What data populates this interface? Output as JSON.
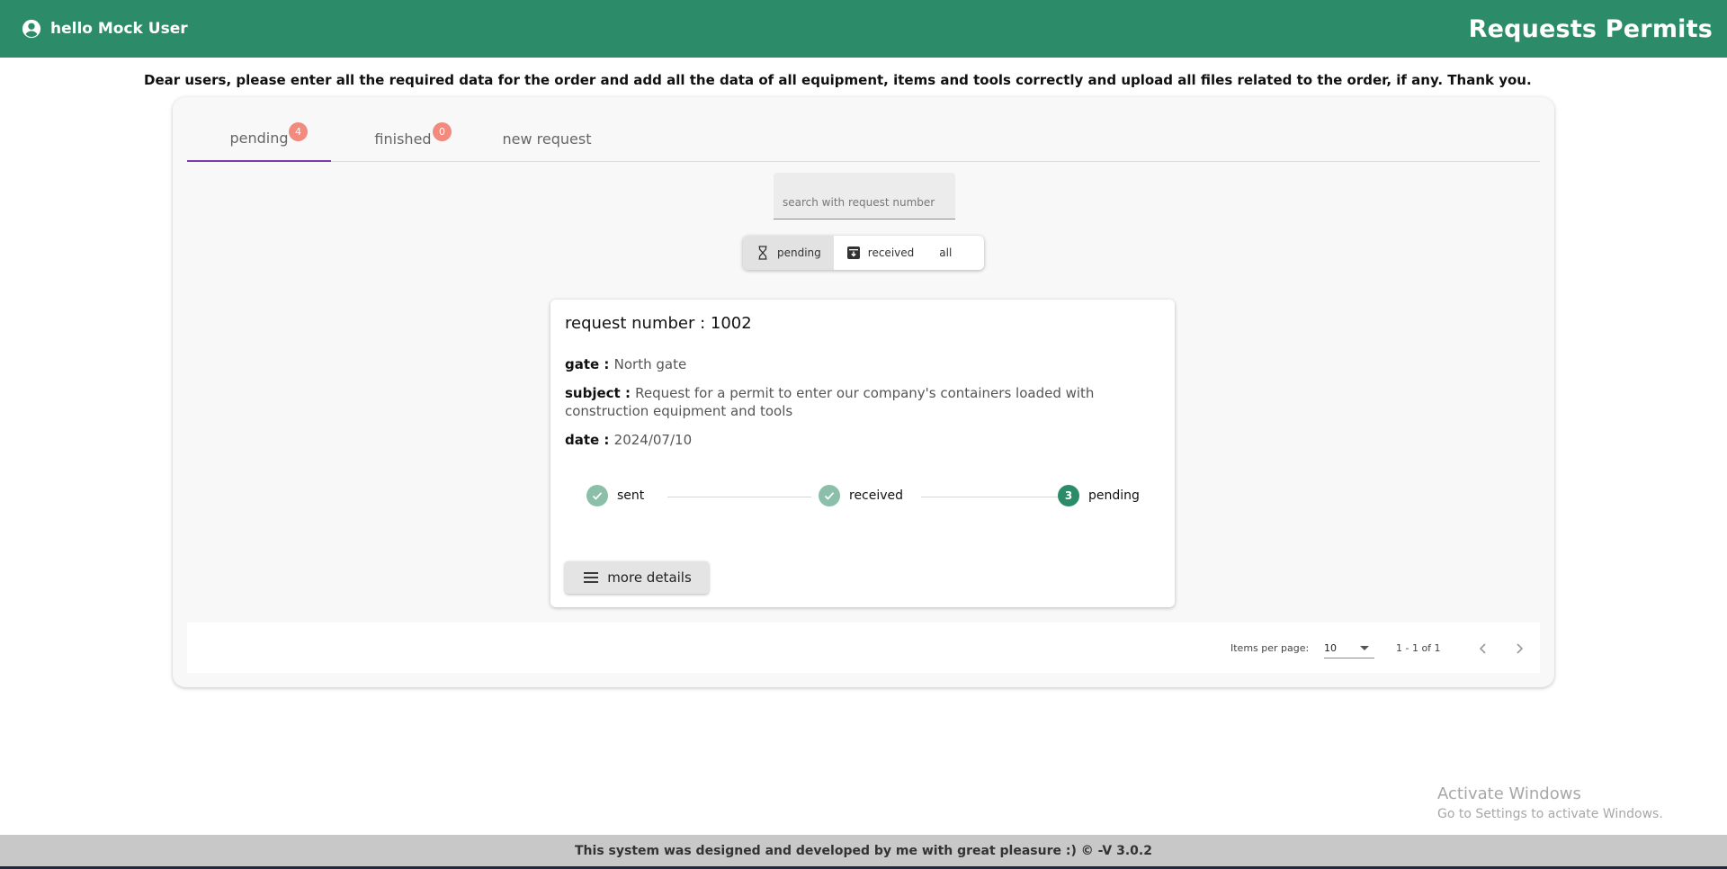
{
  "header": {
    "greeting": "hello Mock User",
    "title": "Requests Permits",
    "background_color": "#2c8c6a"
  },
  "notice": "Dear users, please enter all the required data for the order and add all the data of all equipment, items and tools correctly and upload all files related to the order, if any. Thank you.",
  "tabs": [
    {
      "label": "pending",
      "badge": "4",
      "active": true
    },
    {
      "label": "finished",
      "badge": "0",
      "active": false
    },
    {
      "label": "new request",
      "active": false
    }
  ],
  "search": {
    "placeholder": "search with request number",
    "value": ""
  },
  "filter": {
    "options": [
      {
        "label": "pending",
        "icon": "hourglass-icon",
        "active": true
      },
      {
        "label": "received",
        "icon": "archive-icon",
        "active": false
      },
      {
        "label": "all",
        "active": false
      }
    ]
  },
  "request_card": {
    "title_label": "request number : ",
    "number": "1002",
    "gate_label": "gate : ",
    "gate": "North gate",
    "subject_label": "subject : ",
    "subject": "Request for a permit to enter our company's containers loaded with construction equipment and tools",
    "date_label": "date : ",
    "date": "2024/07/10",
    "steps": [
      {
        "label": "sent",
        "status": "done",
        "icon": "check-icon"
      },
      {
        "label": "received",
        "status": "done",
        "icon": "check-icon"
      },
      {
        "label": "pending",
        "status": "current",
        "number": "3"
      }
    ],
    "more_details_label": "more details"
  },
  "paginator": {
    "items_per_page_label": "Items per page:",
    "items_per_page": "10",
    "range": "1 - 1 of 1"
  },
  "watermark": {
    "line1": "Activate Windows",
    "line2": "Go to Settings to activate Windows."
  },
  "footer": "This system was designed and developed by me with great pleasure :) © -V 3.0.2",
  "colors": {
    "accent": "#2c8c6a",
    "tab_indicator": "#7a3aa8",
    "badge": "#f28a7e",
    "step_done": "#8cbfa9"
  }
}
